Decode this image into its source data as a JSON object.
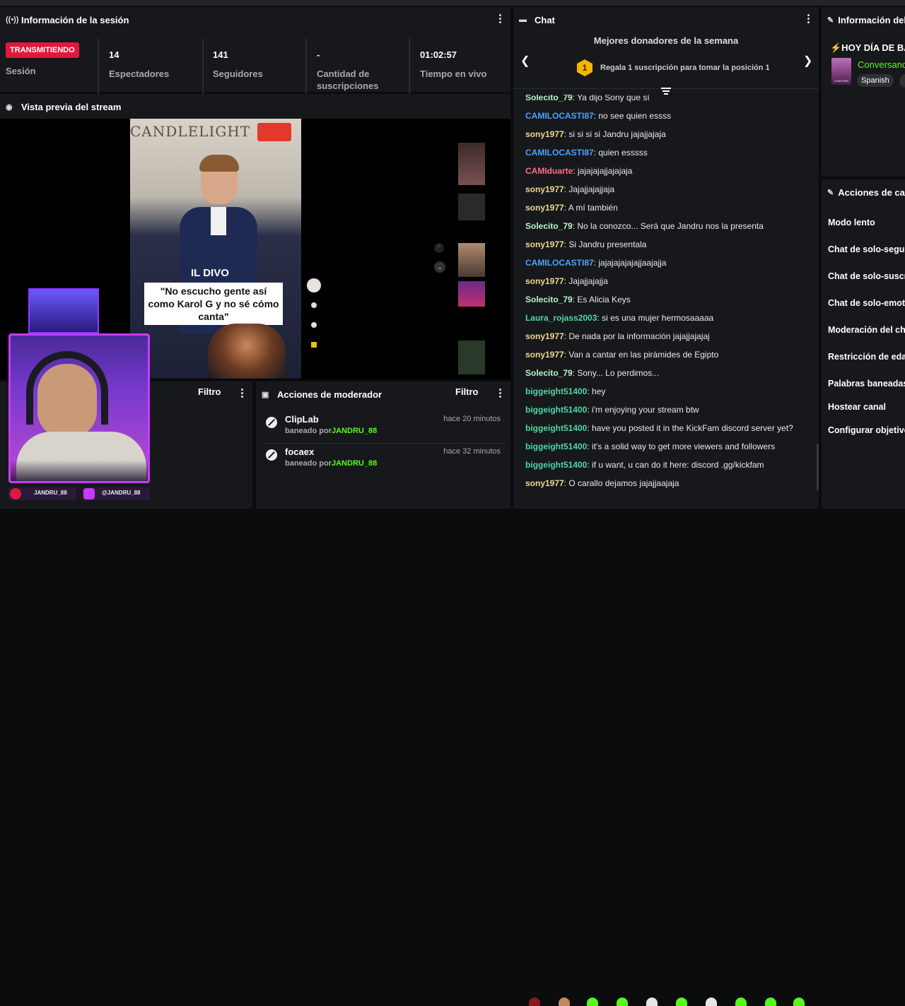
{
  "session": {
    "title": "Información de la sesión",
    "status_badge": "TRANSMITIENDO",
    "status_label": "Sesión",
    "stats": [
      {
        "value": "14",
        "label": "Espectadores"
      },
      {
        "value": "141",
        "label": "Seguidores"
      },
      {
        "value": "-",
        "label": "Cantidad de suscripciones"
      },
      {
        "value": "01:02:57",
        "label": "Tiempo en vivo"
      }
    ]
  },
  "preview": {
    "title": "Vista previa del stream",
    "overlay_top": "CANDLELIGHT",
    "overlay_name": "IL DIVO",
    "overlay_caption": "\"No escucho gente así como Karol G y no sé cómo canta\""
  },
  "left_panel": {
    "filter_label": "Filtro"
  },
  "mod_actions": {
    "title": "Acciones de moderador",
    "filter_label": "Filtro",
    "items": [
      {
        "user": "ClipLab",
        "prefix": "baneado por",
        "by": "JANDRU_88",
        "time": "hace 20 minutos"
      },
      {
        "user": "focaex",
        "prefix": "baneado por",
        "by": "JANDRU_88",
        "time": "hace 32 minutos"
      }
    ]
  },
  "chat": {
    "title": "Chat",
    "top_donors_title": "Mejores donadores de la semana",
    "rank_badge": "1",
    "top_donors_text": "Regala 1 suscripción para tomar la posición 1",
    "messages": [
      {
        "user": "Solecito_79",
        "text": "Ya dijo Sony que sí",
        "color": "#b8f5c8"
      },
      {
        "user": "CAMILOCASTI87",
        "text": "no see quien essss",
        "color": "#4aa3ff"
      },
      {
        "user": "sony1977",
        "text": "si si si si Jandru jajajjajaja",
        "color": "#f0d98c"
      },
      {
        "user": "CAMILOCASTI87",
        "text": "quien esssss",
        "color": "#4aa3ff"
      },
      {
        "user": "CAMIduarte",
        "text": "jajajajajjajajaja",
        "color": "#ff6b8b"
      },
      {
        "user": "sony1977",
        "text": "Jajajjajajjaja",
        "color": "#f0d98c"
      },
      {
        "user": "sony1977",
        "text": "A mí también",
        "color": "#f0d98c"
      },
      {
        "user": "Solecito_79",
        "text": "No la conozco... Será que Jandru nos la presenta",
        "color": "#b8f5c8"
      },
      {
        "user": "sony1977",
        "text": "Si Jandru presentala",
        "color": "#f0d98c"
      },
      {
        "user": "CAMILOCASTI87",
        "text": "jajajajajajajjaajajja",
        "color": "#4aa3ff"
      },
      {
        "user": "sony1977",
        "text": "Jajajjajajja",
        "color": "#f0d98c"
      },
      {
        "user": "Solecito_79",
        "text": "Es Alicia Keys",
        "color": "#b8f5c8"
      },
      {
        "user": "Laura_rojass2003",
        "text": "si es una mujer hermosaaaaa",
        "color": "#4fd6a4"
      },
      {
        "user": "sony1977",
        "text": "De nada por la información jajajjajajaj",
        "color": "#f0d98c"
      },
      {
        "user": "sony1977",
        "text": "Van a cantar en las pirámides de Egipto",
        "color": "#f0d98c"
      },
      {
        "user": "Solecito_79",
        "text": "Sony... Lo perdimos...",
        "color": "#b8f5c8"
      },
      {
        "user": "biggeight51400",
        "text": "hey",
        "color": "#4fd6a4"
      },
      {
        "user": "biggeight51400",
        "text": "i'm enjoying your stream btw",
        "color": "#4fd6a4"
      },
      {
        "user": "biggeight51400",
        "text": "have you posted it in the KickFam discord server yet?",
        "color": "#4fd6a4"
      },
      {
        "user": "biggeight51400",
        "text": "it's a solid way to get more viewers and followers",
        "color": "#4fd6a4"
      },
      {
        "user": "biggeight51400",
        "text": "if u want, u can do it here: discord .gg/kickfam",
        "color": "#4fd6a4"
      },
      {
        "user": "sony1977",
        "text": "O carallo dejamos jajajjaajaja",
        "color": "#f0d98c"
      }
    ]
  },
  "stream_info": {
    "title": "Información del",
    "stream_title": "⚡HOY DÍA DE BAT",
    "category": "Conversand",
    "language": "Spanish",
    "thumb_text": "CHATTING"
  },
  "channel_actions": {
    "title": "Acciones de can",
    "items": [
      "Modo lento",
      "Chat de solo-segui",
      "Chat de solo-suscr",
      "Chat de solo-emote",
      "Moderación del cha",
      "Restricción de eda",
      "Palabras baneadas",
      "Hostear canal",
      "Configurar objetivo"
    ]
  },
  "webcam": {
    "social_1": "JANDRU_88",
    "social_2": "@JANDRU_88"
  },
  "colors": {
    "live": "#e0183d",
    "accent_green": "#53fc18",
    "webcam_frame": "#c73bff"
  }
}
